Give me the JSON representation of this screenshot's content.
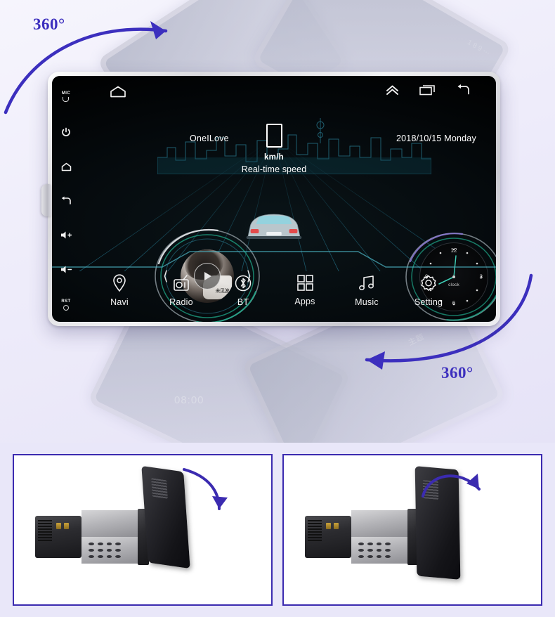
{
  "hero": {
    "rotation_top": {
      "label": "360°",
      "color": "#3c2fbe",
      "direction": "clockwise-right"
    },
    "rotation_bottom": {
      "label": "360°",
      "color": "#3c2fbe",
      "direction": "counterclockwise-left"
    },
    "ghost_screens": {
      "clock_text": "08:00",
      "app_label_cn": "主题",
      "power_glyph": "⏻",
      "side_column": "1 8 9 ⋯"
    }
  },
  "head_unit": {
    "side_keys": [
      {
        "name": "mic-key",
        "label": "MIC",
        "icon": "microphone-icon"
      },
      {
        "name": "power-key",
        "label": "",
        "icon": "power-icon"
      },
      {
        "name": "home-key",
        "label": "",
        "icon": "home-icon"
      },
      {
        "name": "back-key",
        "label": "",
        "icon": "back-arrow-icon"
      },
      {
        "name": "volume-up-key",
        "label": "",
        "icon": "volume-up-icon"
      },
      {
        "name": "volume-down-key",
        "label": "",
        "icon": "volume-down-icon"
      },
      {
        "name": "reset-key",
        "label": "RST",
        "icon": "reset-pinhole-icon"
      }
    ],
    "status_bar": {
      "home_icon": "home-outline-icon",
      "right_icons": [
        "double-chevron-up-icon",
        "recent-apps-icon",
        "back-arrow-icon"
      ]
    },
    "now_playing": {
      "track_title": "OneILove",
      "album_text": "未见波",
      "play_icon": "play-icon",
      "prev_icon": "chevron-left-icon",
      "next_icon": "chevron-right-icon"
    },
    "speedometer": {
      "value": "",
      "unit": "km/h",
      "caption": "Real-time speed"
    },
    "datetime": {
      "date": "2018/10/15",
      "weekday": "Monday",
      "combined": "2018/10/15   Monday"
    },
    "clock_widget": {
      "label": "clock",
      "numerals": {
        "n12": "12",
        "n3": "3",
        "n6": "6",
        "n9": "9"
      },
      "hour_hand_deg": 250,
      "minute_hand_deg": 8
    },
    "dock": [
      {
        "label": "Navi",
        "icon": "location-pin-icon"
      },
      {
        "label": "Radio",
        "icon": "radio-icon"
      },
      {
        "label": "BT",
        "icon": "bluetooth-icon"
      },
      {
        "label": "Apps",
        "icon": "grid-apps-icon"
      },
      {
        "label": "Music",
        "icon": "music-note-icon"
      },
      {
        "label": "Setting",
        "icon": "gear-icon"
      }
    ],
    "theme": {
      "accent_teal": "#1fa88a",
      "accent_blue": "#5aa8c8",
      "screen_black": "#000000",
      "text_white": "#ffffff"
    }
  },
  "panels": [
    {
      "name": "tilt-photo-left",
      "arrow": "tilt-down-arrow",
      "arrow_color": "#3b2bb0"
    },
    {
      "name": "tilt-photo-right",
      "arrow": "tilt-down-arrow",
      "arrow_color": "#3b2bb0"
    }
  ]
}
